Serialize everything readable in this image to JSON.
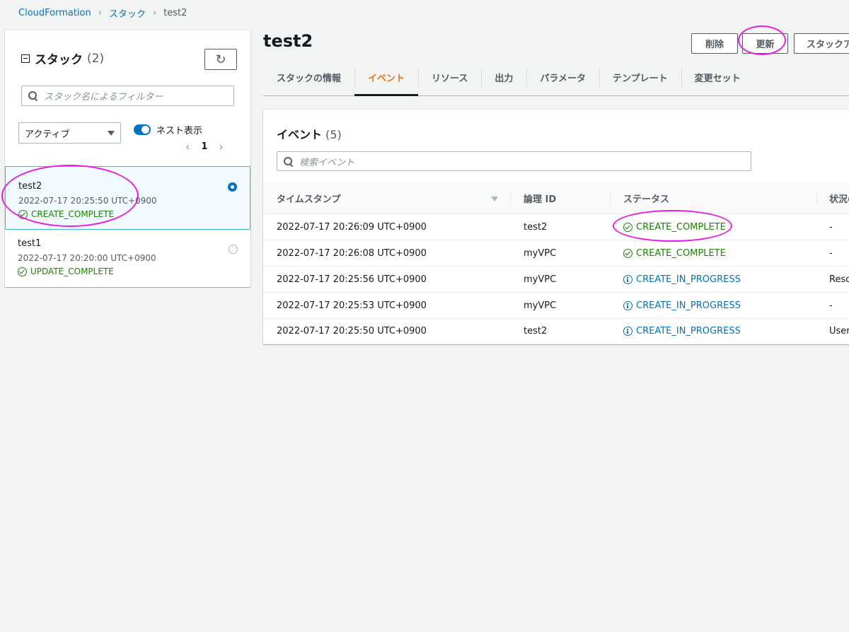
{
  "breadcrumb": {
    "root": "CloudFormation",
    "section": "スタック",
    "current": "test2"
  },
  "stacks_panel": {
    "title": "スタック",
    "count": "(2)",
    "search_placeholder": "スタック名によるフィルター",
    "filter_value": "アクティブ",
    "nested_toggle_label": "ネスト表示",
    "nested_toggle_on": true,
    "page": "1",
    "items": [
      {
        "name": "test2",
        "timestamp": "2022-07-17 20:25:50 UTC+0900",
        "status": "CREATE_COMPLETE",
        "selected": true
      },
      {
        "name": "test1",
        "timestamp": "2022-07-17 20:20:00 UTC+0900",
        "status": "UPDATE_COMPLETE",
        "selected": false
      }
    ]
  },
  "header": {
    "title": "test2",
    "buttons": {
      "delete": "削除",
      "update": "更新",
      "stack_actions": "スタックア"
    }
  },
  "tabs": [
    {
      "label": "スタックの情報",
      "active": false
    },
    {
      "label": "イベント",
      "active": true
    },
    {
      "label": "リソース",
      "active": false
    },
    {
      "label": "出力",
      "active": false
    },
    {
      "label": "パラメータ",
      "active": false
    },
    {
      "label": "テンプレート",
      "active": false
    },
    {
      "label": "変更セット",
      "active": false
    }
  ],
  "events": {
    "title": "イベント",
    "count": "(5)",
    "search_placeholder": "検索イベント",
    "columns": {
      "timestamp": "タイムスタンプ",
      "logical_id": "論理 ID",
      "status": "ステータス",
      "reason": "状況の"
    },
    "rows": [
      {
        "timestamp": "2022-07-17 20:26:09 UTC+0900",
        "logical_id": "test2",
        "status": "CREATE_COMPLETE",
        "status_kind": "complete",
        "reason": "-"
      },
      {
        "timestamp": "2022-07-17 20:26:08 UTC+0900",
        "logical_id": "myVPC",
        "status": "CREATE_COMPLETE",
        "status_kind": "complete",
        "reason": "-"
      },
      {
        "timestamp": "2022-07-17 20:25:56 UTC+0900",
        "logical_id": "myVPC",
        "status": "CREATE_IN_PROGRESS",
        "status_kind": "progress",
        "reason": "Reso"
      },
      {
        "timestamp": "2022-07-17 20:25:53 UTC+0900",
        "logical_id": "myVPC",
        "status": "CREATE_IN_PROGRESS",
        "status_kind": "progress",
        "reason": "-"
      },
      {
        "timestamp": "2022-07-17 20:25:50 UTC+0900",
        "logical_id": "test2",
        "status": "CREATE_IN_PROGRESS",
        "status_kind": "progress",
        "reason": "User"
      }
    ]
  },
  "colors": {
    "link": "#0073bb",
    "success": "#1d8102",
    "accent_tab": "#ec7211",
    "annotation": "#e81ee0"
  }
}
